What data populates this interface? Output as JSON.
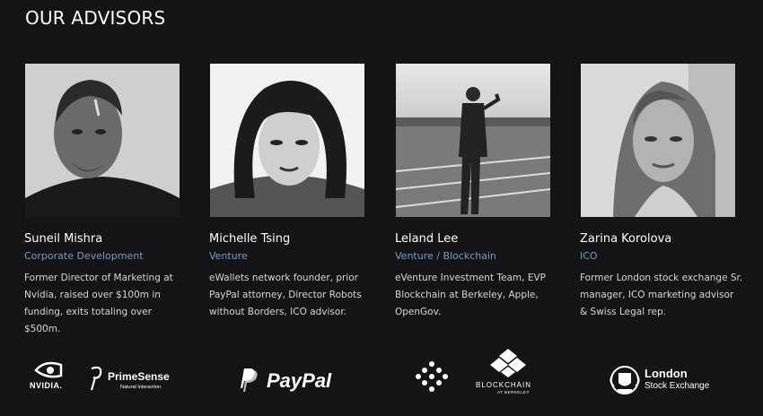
{
  "section": {
    "title": "OUR ADVISORS"
  },
  "advisors": [
    {
      "name": "Suneil Mishra",
      "role": "Corporate Development",
      "bio": "Former Director of Marketing at Nvidia, raised over $100m in funding, exits totaling over $500m."
    },
    {
      "name": "Michelle Tsing",
      "role": "Venture",
      "bio": "eWallets network founder, prior PayPal attorney, Director Robots without Borders, ICO advisor."
    },
    {
      "name": "Leland Lee",
      "role": "Venture / Blockchain",
      "bio": "eVenture Investment Team, EVP Blockchain at Berkeley, Apple, OpenGov."
    },
    {
      "name": "Zarina Korolova",
      "role": "ICO",
      "bio": "Former London stock exchange Sr. manager, ICO marketing advisor & Swiss Legal rep."
    }
  ],
  "logos": {
    "nvidia": "NVIDIA.",
    "primesense": {
      "name": "PrimeSense",
      "tagline": "Natural Interaction"
    },
    "paypal": "PayPal",
    "blockchain": {
      "name": "BLOCKCHAIN",
      "sub": "AT BERKELEY"
    },
    "lse": {
      "line1": "London",
      "line2": "Stock Exchange"
    }
  },
  "colors": {
    "background": "#141416",
    "role_accent": "#6f9fc6",
    "text": "#ffffff"
  },
  "icons": [
    "nvidia-logo-icon",
    "primesense-logo-icon",
    "paypal-logo-icon",
    "dots-logo-icon",
    "blockchain-logo-icon",
    "lse-crest-icon"
  ]
}
